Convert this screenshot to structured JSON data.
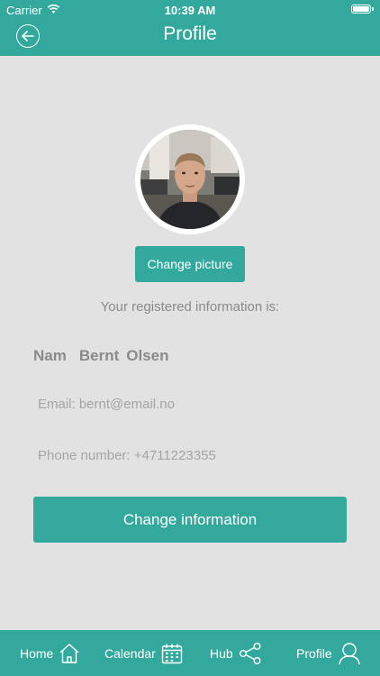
{
  "status_bar": {
    "carrier": "Carrier",
    "time": "10:39 AM"
  },
  "nav": {
    "title": "Profile",
    "back_icon": "back-arrow-icon"
  },
  "profile": {
    "change_picture_label": "Change picture",
    "info_heading": "Your registered information is:",
    "name_label": "Nam",
    "first_name": "Bernt",
    "last_name": "Olsen",
    "email_text": "Email: bernt@email.no",
    "phone_text": "Phone number: +4711223355",
    "change_info_label": "Change information"
  },
  "tabs": [
    {
      "label": "Home",
      "icon": "home-icon"
    },
    {
      "label": "Calendar",
      "icon": "calendar-icon"
    },
    {
      "label": "Hub",
      "icon": "share-icon"
    },
    {
      "label": "Profile",
      "icon": "user-icon"
    }
  ],
  "colors": {
    "accent": "#33a89d",
    "background": "#e2e2e2",
    "muted_text": "#8a8a8a"
  }
}
